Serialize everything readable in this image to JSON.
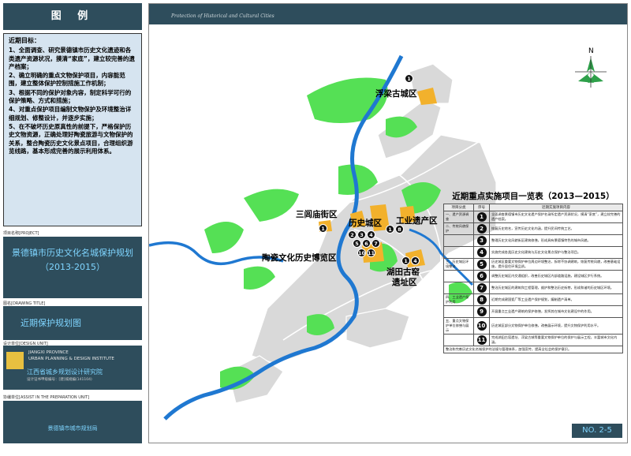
{
  "sidebar": {
    "legend_title": "图 例",
    "goals_title": "近期目标：",
    "goals": [
      "1、全面调查、研究景德镇市历史文化遗迹和各类遗产资源状况，摸清“家底”，建立较完善的遗产档案；",
      "2、确立明确的重点文物保护项目，内容能范围，建立整体保护控制措施工作机制；",
      "3、根据不同的保护对象内容，制定科学可行的保护策略、方式和措施；",
      "4、对重点保护项目编制文物保护及环境整治详细规划、修整设计，并逐步实施；",
      "5、在不破坏历史原真性的前提下，严格保护历史文物资源，正确处理好陶瓷旅游与文物保护的关系，整合陶瓷历史文化景点项目，合理组织游览线路，基本形成完善的展示利用体系。"
    ],
    "project_label": "项目名称[PROJECT]",
    "project_title_1": "景德镇市历史文化名城保护规划",
    "project_title_2": "（2013-2015）",
    "drawing_label": "图名[DRAWING TITLE]",
    "drawing_title": "近期保护规划图",
    "unit_label": "设计单位[DESIGN UNIT]",
    "unit_en_1": "JIANGXI PROVINCE",
    "unit_en_2": "URBAN PLANNING & DESIGN INSTITUTE",
    "unit_cn": "江西省城乡规划设计研究院",
    "unit_cert": "设计证书甲级编号：[建]城规编(141104)",
    "assist_label": "协编单位[ASSIST IN THE PREPARATION UNIT]",
    "assist_name": "景德镇市城市规划局"
  },
  "main": {
    "banner": "Protection of Historical and Cultural Cities",
    "sheet_no": "NO. 2-5",
    "north_label": "N"
  },
  "map_labels": {
    "fuliang": "浮梁古城区",
    "sanlv": "三闾庙街区",
    "lishi": "历史城区",
    "gongye": "工业遗产区",
    "taoci": "陶瓷文化历史博览区",
    "hutian_1": "湖田古窑",
    "hutian_2": "遗址区"
  },
  "table": {
    "title": "近期重点实施项目一览表（2013—2015）",
    "headers": [
      "项目分类",
      "序号",
      "近期实施项目内容"
    ],
    "rows": [
      {
        "cat": "一、遗产资源调查",
        "num": "1",
        "text": "全面调查景德镇市历史文化遗产保护名录所定遗产资源状况，摸清“家底”，建立较完善的遗产档案。"
      },
      {
        "cat": "二、传统风貌保护",
        "num": "2",
        "text": "恢复历史地名，宣传历史文化内涵，提升民间传统工艺。"
      },
      {
        "cat": "",
        "num": "3",
        "text": "整理历史文化风貌街区建筑修缮，形成具有景德镇特色的城市风貌。"
      },
      {
        "cat": "",
        "num": "4",
        "text": "实施完成各类历史文化建筑与历史文化景点保护与整治项目。"
      },
      {
        "cat": "三、历史城区环境整治",
        "num": "5",
        "text": "历史城区重要文物保护单位周边环境整治，拆除不协调建筑，恢复传统风貌，改善基础设施，提升居住环境品质。"
      },
      {
        "cat": "",
        "num": "6",
        "text": "调整历史城区内交通组织，改善历史城区内部道路设施，建设城区步行系统。"
      },
      {
        "cat": "",
        "num": "7",
        "text": "整治历史城区的建筑和工程管理，维护和整治历史街巷，形成和谐的历史城区环境。"
      },
      {
        "cat": "四、工业遗产保护利用",
        "num": "8",
        "text": "近期完成建国瓷厂等工业遗产保护规划，编制遗产清单。"
      },
      {
        "cat": "",
        "num": "9",
        "text": "开展重点工业遗产建筑的保护修缮，发挥其在城市文化建设中的作用。"
      },
      {
        "cat": "五、重点文物保护单位修缮与展示",
        "num": "10",
        "text": "历史城区部分文物保护单位修缮，改善展示环境，提升文物保护利用水平。"
      },
      {
        "cat": "",
        "num": "11",
        "text": "完成湖田古窑遗址、浮梁古城等重要文物保护单位的保护与展示工程，丰富城市文化内涵。"
      },
      {
        "cat": "六、整治和完善历史文化名城保护管理机制",
        "num": "",
        "text": "整治和完善历史文化名城保护的法规与管理体系，加强宣传，提高全社会的保护意识。"
      }
    ]
  },
  "colors": {
    "panel": "#2e4d5c",
    "accent_text": "#7fd5ff",
    "goals_bg": "#d6e4f0",
    "river": "#1f78d1",
    "green": "#55e055",
    "heritage": "#f2b12c",
    "block": "#d9d9d9",
    "road": "#ffffff"
  },
  "icons": [
    "north-arrow-icon",
    "logo-icon"
  ]
}
